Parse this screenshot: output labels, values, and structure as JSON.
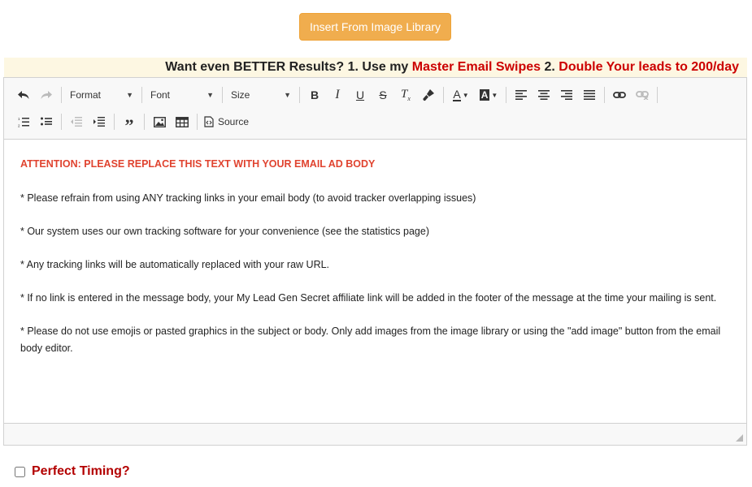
{
  "insert_button": {
    "label": "Insert From Image Library"
  },
  "promo": {
    "prefix": "Want even BETTER Results? 1. Use my ",
    "link1": "Master Email Swipes",
    "middle": " 2. ",
    "link2": "Double Your leads to 200/day"
  },
  "toolbar": {
    "format_label": "Format",
    "font_label": "Font",
    "size_label": "Size",
    "source_label": "Source"
  },
  "body": {
    "attention": "ATTENTION: PLEASE REPLACE THIS TEXT WITH YOUR EMAIL AD BODY",
    "lines": [
      "* Please refrain from using ANY tracking links in your email body (to avoid tracker overlapping issues)",
      "* Our system uses our own tracking software for your convenience (see the statistics page)",
      "* Any tracking links will be automatically replaced with your raw URL.",
      "* If no link is entered in the message body, your My Lead Gen Secret affiliate link will be added in the footer of the message at the time your mailing is sent.",
      "* Please do not use emojis or pasted graphics in the subject or body. Only add images from the image library or using the \"add image\" button from the email body editor."
    ]
  },
  "timing": {
    "label": "Perfect Timing?",
    "checked": false
  },
  "colors": {
    "accent_orange": "#f0ad4e",
    "promo_red": "#cc0000",
    "attention_red": "#e0432f"
  }
}
